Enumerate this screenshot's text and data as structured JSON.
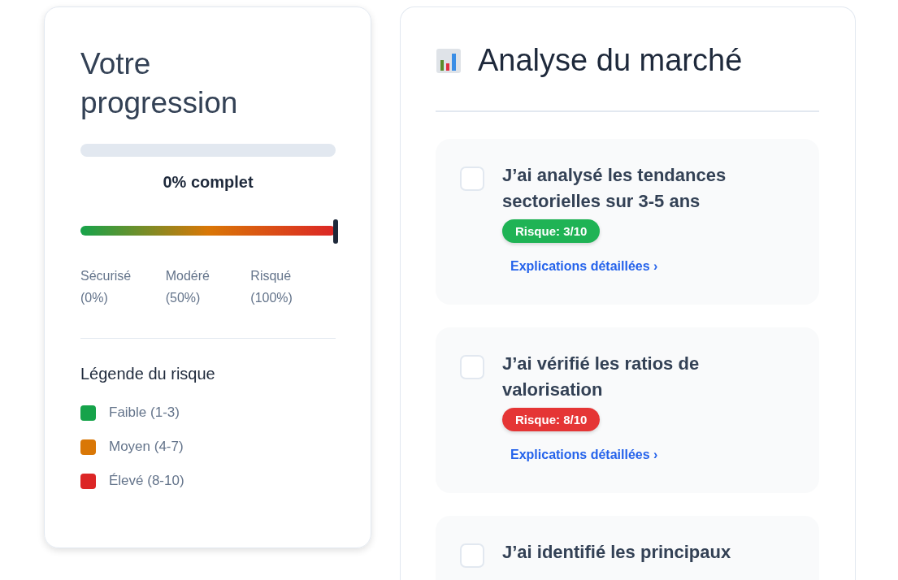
{
  "progress": {
    "title": "Votre progression",
    "level": 0,
    "label": "0% complet",
    "risk_meter": {
      "level": 1,
      "scale": [
        {
          "name": "Sécurisé",
          "value": "(0%)"
        },
        {
          "name": "Modéré",
          "value": "(50%)"
        },
        {
          "name": "Risqué",
          "value": "(100%)"
        }
      ]
    },
    "legend": {
      "title": "Légende du risque",
      "items": [
        {
          "label": "Faible (1-3)",
          "color": "#16a34a"
        },
        {
          "label": "Moyen (4-7)",
          "color": "#d97706"
        },
        {
          "label": "Élevé (8-10)",
          "color": "#dc2626"
        }
      ]
    }
  },
  "section": {
    "title": "Analyse du marché",
    "items": [
      {
        "text": "J’ai analysé les tendances sectorielles sur 3-5 ans",
        "checked": false,
        "risk": "Risque: 3/10",
        "color": "#1fb355",
        "link": "Explications détaillées ›"
      },
      {
        "text": "J’ai vérifié les ratios de valorisation",
        "checked": false,
        "risk": "Risque: 8/10",
        "color": "#e53535",
        "link": "Explications détaillées ›"
      },
      {
        "text": "J’ai identifié les principaux",
        "checked": false
      }
    ]
  }
}
